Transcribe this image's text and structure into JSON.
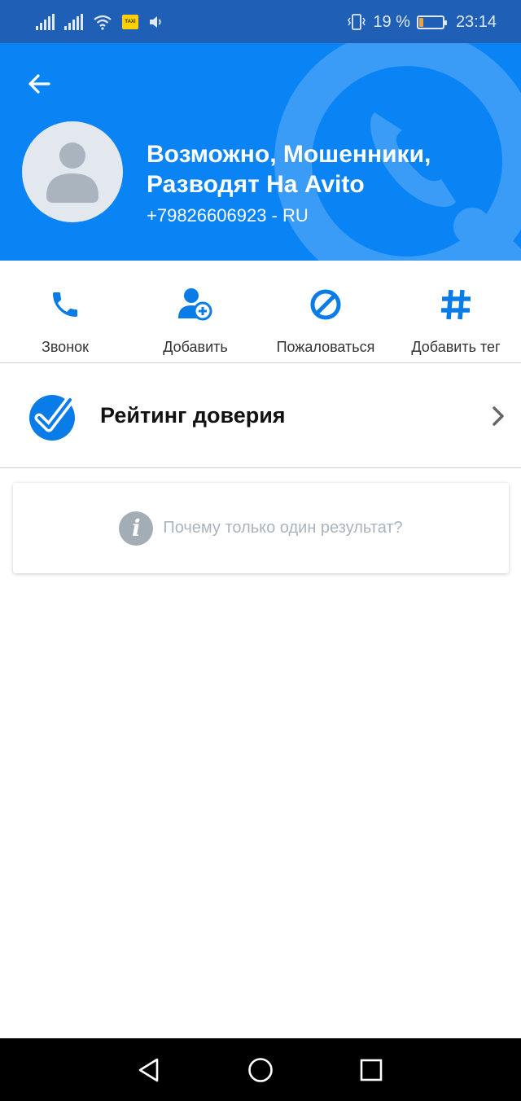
{
  "status_bar": {
    "sim_badge": "TAXI",
    "battery_percent": "19 %",
    "battery_level": 0.19,
    "time": "23:14",
    "icons": [
      "signal-icon",
      "signal-icon",
      "wifi-icon",
      "sim-badge-icon",
      "volume-icon",
      "vibrate-icon",
      "battery-icon"
    ]
  },
  "header": {
    "back_icon": "arrow-back-icon",
    "name": "Возможно, Мошенники, Разводят На Avito",
    "number": "+79826606923 - RU",
    "background_color": "#0a84f5"
  },
  "actions": [
    {
      "label": "Звонок",
      "icon": "phone-icon"
    },
    {
      "label": "Добавить",
      "icon": "add-contact-icon"
    },
    {
      "label": "Пожаловаться",
      "icon": "block-icon"
    },
    {
      "label": "Добавить тег",
      "icon": "hashtag-icon"
    }
  ],
  "trust": {
    "label": "Рейтинг доверия",
    "icon": "trust-check-icon",
    "chevron": "chevron-right-icon"
  },
  "info": {
    "text": "Почему только один результат?",
    "icon": "info-icon"
  },
  "nav": {
    "icons": [
      "back-triangle-icon",
      "home-circle-icon",
      "recents-square-icon"
    ]
  },
  "colors": {
    "accent": "#0a84f5",
    "status_bar": "#1f5fb6",
    "icon_blue": "#0a7ce8"
  }
}
